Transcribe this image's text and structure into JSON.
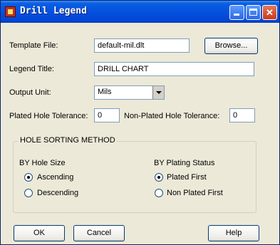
{
  "window": {
    "title": "Drill Legend"
  },
  "fields": {
    "template_file": {
      "label": "Template File:",
      "value": "default-mil.dlt"
    },
    "browse_button": "Browse...",
    "legend_title": {
      "label": "Legend Title:",
      "value": "DRILL CHART"
    },
    "output_unit": {
      "label": "Output Unit:",
      "value": "Mils"
    },
    "plated_tolerance": {
      "label": "Plated Hole Tolerance:",
      "value": "0"
    },
    "non_plated_tolerance": {
      "label": "Non-Plated Hole Tolerance:",
      "value": "0"
    }
  },
  "sorting": {
    "group_title": "HOLE SORTING METHOD",
    "by_size": {
      "label": "BY Hole Size",
      "options": [
        {
          "label": "Ascending",
          "checked": true
        },
        {
          "label": "Descending",
          "checked": false
        }
      ]
    },
    "by_plating": {
      "label": "BY Plating Status",
      "options": [
        {
          "label": "Plated First",
          "checked": true
        },
        {
          "label": "Non Plated First",
          "checked": false
        }
      ]
    }
  },
  "buttons": {
    "ok": "OK",
    "cancel": "Cancel",
    "help": "Help"
  },
  "icons": {
    "app": "app-icon",
    "minimize": "minimize-icon",
    "maximize": "maximize-icon",
    "close": "close-icon"
  }
}
